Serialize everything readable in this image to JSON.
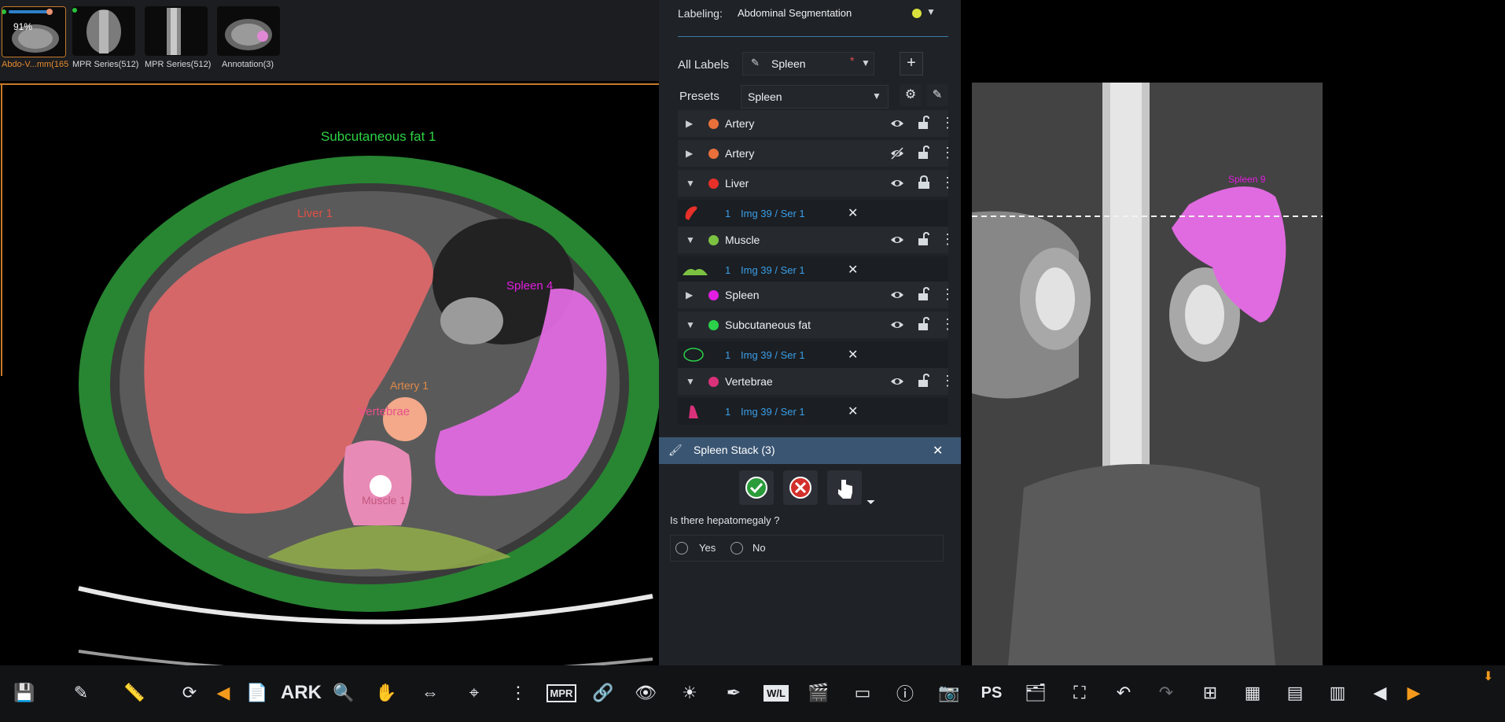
{
  "thumbnails": [
    {
      "caption": "Abdo-V...mm(165",
      "badge": "91%",
      "active": true
    },
    {
      "caption": "MPR Series(512)"
    },
    {
      "caption": "MPR Series(512)"
    },
    {
      "caption": "Annotation(3)"
    }
  ],
  "left_viewport": {
    "labels": {
      "subcutaneous": "Subcutaneous fat 1",
      "liver": "Liver 1",
      "spleen": "Spleen 4",
      "artery": "Artery 1",
      "vertebrae": "Vertebrae",
      "muscle": "Muscle 1"
    }
  },
  "right_viewport": {
    "spleen_label": "Spleen 9"
  },
  "panel": {
    "labeling_label": "Labeling:",
    "labeling_value": "Abdominal Segmentation",
    "all_labels_label": "All Labels",
    "all_labels_value": "Spleen",
    "presets_label": "Presets",
    "presets_value": "Spleen",
    "items": [
      {
        "name": "Artery",
        "color": "#e8703a",
        "expanded": false
      },
      {
        "name": "Artery",
        "color": "#e8703a",
        "expanded": false,
        "hidden": true
      },
      {
        "name": "Liver",
        "color": "#e8302a",
        "expanded": true,
        "locked": true,
        "sub": {
          "count": "1",
          "link": "Img 39 / Ser 1"
        }
      },
      {
        "name": "Muscle",
        "color": "#7cc242",
        "expanded": true,
        "sub": {
          "count": "1",
          "link": "Img 39 / Ser 1"
        }
      },
      {
        "name": "Spleen",
        "color": "#e21ee0",
        "expanded": false
      },
      {
        "name": "Subcutaneous fat",
        "color": "#2bd14b",
        "expanded": true,
        "sub": {
          "count": "1",
          "link": "Img 39 / Ser 1"
        }
      },
      {
        "name": "Vertebrae",
        "color": "#d9327a",
        "expanded": true,
        "sub": {
          "count": "1",
          "link": "Img 39 / Ser 1"
        }
      }
    ]
  },
  "dialog": {
    "title": "Spleen Stack (3)",
    "question": "Is there hepatomegaly ?",
    "options": [
      "Yes",
      "No"
    ]
  },
  "toolbar": {
    "ark_label": "ARK",
    "mpr_label": "MPR",
    "wl_label": "W/L",
    "ps_label": "PS"
  },
  "colors": {
    "accent": "#3a9ee8",
    "orange": "#f39a1c",
    "dialog_header": "#3a5572"
  }
}
